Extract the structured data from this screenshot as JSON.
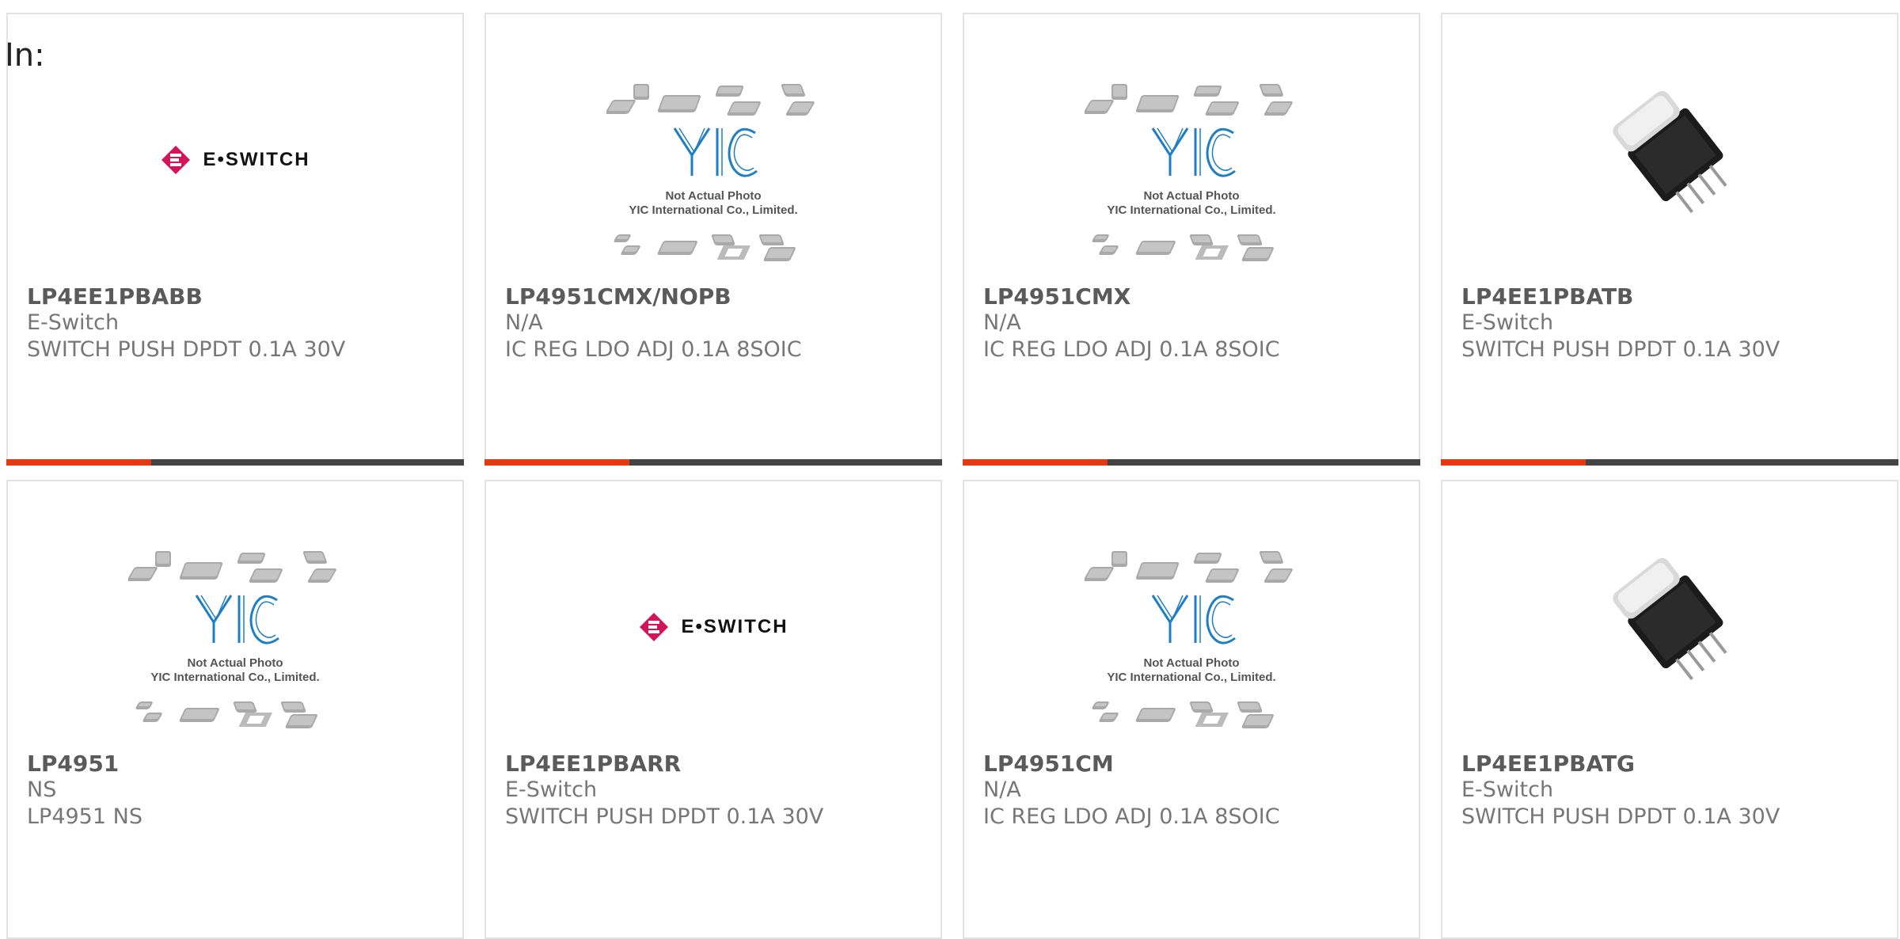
{
  "filter_label": "In:",
  "products": [
    {
      "part_number": "LP4EE1PBABB",
      "manufacturer": "E-Switch",
      "description": "SWITCH PUSH DPDT 0.1A 30V",
      "image": "eswitch-logo",
      "logo_text": "E•SWITCH"
    },
    {
      "part_number": "LP4951CMX/NOPB",
      "manufacturer": "N/A",
      "description": "IC REG LDO ADJ 0.1A 8SOIC",
      "image": "yic-placeholder",
      "logo_text": "YIC",
      "caption1": "Not Actual Photo",
      "caption2": "YIC International Co., Limited."
    },
    {
      "part_number": "LP4951CMX",
      "manufacturer": "N/A",
      "description": "IC REG LDO ADJ 0.1A 8SOIC",
      "image": "yic-placeholder",
      "logo_text": "YIC",
      "caption1": "Not Actual Photo",
      "caption2": "YIC International Co., Limited."
    },
    {
      "part_number": "LP4EE1PBATB",
      "manufacturer": "E-Switch",
      "description": "SWITCH PUSH DPDT 0.1A 30V",
      "image": "push-switch-photo"
    },
    {
      "part_number": "LP4951",
      "manufacturer": "NS",
      "description": "LP4951 NS",
      "image": "yic-placeholder",
      "logo_text": "YIC",
      "caption1": "Not Actual Photo",
      "caption2": "YIC International Co., Limited."
    },
    {
      "part_number": "LP4EE1PBARR",
      "manufacturer": "E-Switch",
      "description": "SWITCH PUSH DPDT 0.1A 30V",
      "image": "eswitch-logo",
      "logo_text": "E•SWITCH"
    },
    {
      "part_number": "LP4951CM",
      "manufacturer": "N/A",
      "description": "IC REG LDO ADJ 0.1A 8SOIC",
      "image": "yic-placeholder",
      "logo_text": "YIC",
      "caption1": "Not Actual Photo",
      "caption2": "YIC International Co., Limited."
    },
    {
      "part_number": "LP4EE1PBATG",
      "manufacturer": "E-Switch",
      "description": "SWITCH PUSH DPDT 0.1A 30V",
      "image": "push-switch-photo"
    }
  ],
  "colors": {
    "accent": "#e23b14",
    "bar_dark": "#444444",
    "eswitch_logo": "#d4145a",
    "yic_blue": "#1e7fc4"
  }
}
